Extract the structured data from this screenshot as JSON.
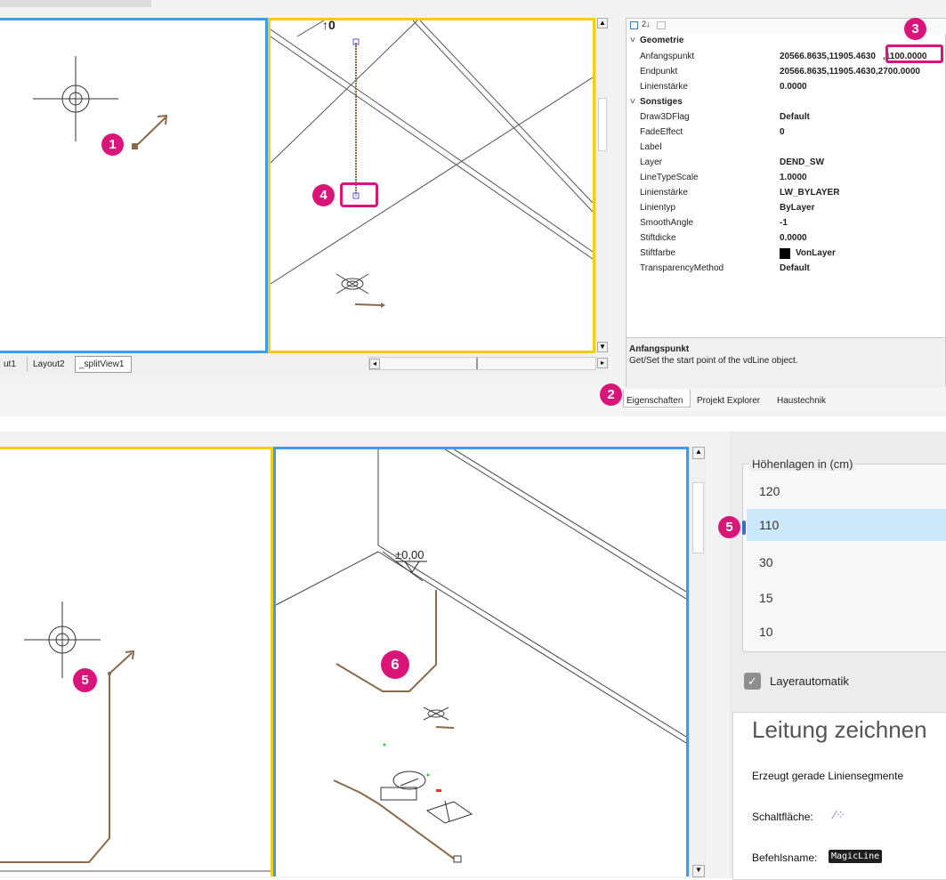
{
  "top": {
    "tabs": [
      "ut1",
      "Layout2",
      "_splitView1"
    ],
    "badges": [
      "1",
      "2",
      "3",
      "4"
    ],
    "properties": {
      "toolbar_icons": [
        "categorized-icon",
        "sort-az-icon",
        "pages-icon"
      ],
      "groups": [
        {
          "name": "Geometrie",
          "rows": [
            {
              "key": "Anfangspunkt",
              "value": "20566.8635,11905.4630",
              "highlight": ",1100.0000"
            },
            {
              "key": "Endpunkt",
              "value": "20566.8635,11905.4630,2700.0000"
            },
            {
              "key": "Linienstärke",
              "value": "0.0000"
            }
          ]
        },
        {
          "name": "Sonstiges",
          "rows": [
            {
              "key": "Draw3DFlag",
              "value": "Default"
            },
            {
              "key": "FadeEffect",
              "value": "0"
            },
            {
              "key": "Label",
              "value": ""
            },
            {
              "key": "Layer",
              "value": "DEND_SW"
            },
            {
              "key": "LineTypeScale",
              "value": "1.0000"
            },
            {
              "key": "Linienstärke",
              "value": "LW_BYLAYER"
            },
            {
              "key": "Linientyp",
              "value": "ByLayer"
            },
            {
              "key": "SmoothAngle",
              "value": "-1"
            },
            {
              "key": "Stiftdicke",
              "value": "0.0000"
            },
            {
              "key": "Stiftfarbe",
              "value": "VonLayer",
              "swatch": "#000000"
            },
            {
              "key": "TransparencyMethod",
              "value": "Default"
            }
          ]
        }
      ],
      "description_title": "Anfangspunkt",
      "description_text": "Get/Set the start point of the vdLine object.",
      "bottom_tabs": [
        "Eigenschaften",
        "Projekt Explorer",
        "Haustechnik"
      ]
    }
  },
  "bottom": {
    "badges": [
      "5",
      "6",
      "5"
    ],
    "elevation_label": "±0,00",
    "hoehenlagen": {
      "legend": "Höhenlagen in (cm)",
      "items": [
        "120",
        "110",
        "30",
        "15",
        "10"
      ],
      "selected_index": 1
    },
    "layerautomatik": {
      "label": "Layerautomatik",
      "checked": true
    },
    "info": {
      "title": "Leitung zeichnen",
      "description": "Erzeugt gerade Liniensegmente",
      "button_label": "Schaltfläche:",
      "command_label": "Befehlsname:",
      "command_name": "MagicLine"
    }
  },
  "colors": {
    "accent_magenta": "#d9157a",
    "viewport_blue": "#3d9bf0",
    "viewport_yellow": "#f7cc16",
    "pipe_brown": "#8b6a4a",
    "selected_row": "#cce8fb"
  }
}
